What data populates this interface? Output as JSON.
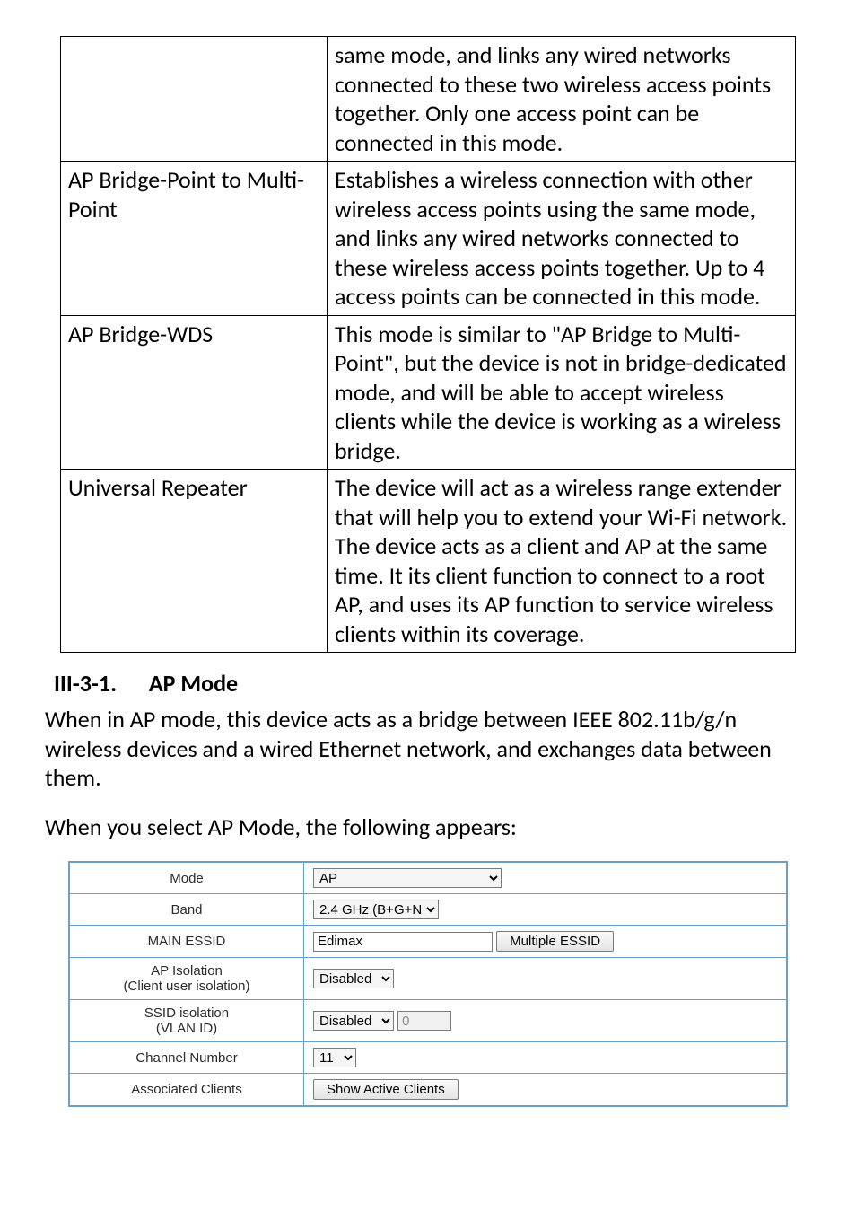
{
  "ref_table": {
    "rows": [
      {
        "label": "",
        "desc": "same mode, and links any wired networks connected to these two wireless access points together. Only one access point can be connected in this mode."
      },
      {
        "label": "AP Bridge-Point to Multi-Point",
        "desc": "Establishes a wireless connection with other wireless access points using the same mode, and links any wired networks connected to these wireless access points together. Up to 4 access points can be connected in this mode."
      },
      {
        "label": "AP Bridge-WDS",
        "desc": "This mode is similar to \"AP Bridge to Multi-Point\", but the device is not in bridge-dedicated mode, and will be able to accept wireless clients while the device is working as a wireless bridge."
      },
      {
        "label": "Universal Repeater",
        "desc": "The device will act as a wireless range extender that will help you to extend your Wi-Fi network. The device acts as a client and AP at the same time. It its client function to connect to a root AP, and uses its AP function to service wireless clients within its coverage."
      }
    ]
  },
  "section": {
    "number": "III-3-1.",
    "title": "AP Mode",
    "para1": "When in AP mode, this device acts as a bridge between IEEE 802.11b/g/n wireless devices and a wired Ethernet network, and exchanges data between them.",
    "para2": "When you select AP Mode, the following appears:"
  },
  "settings": {
    "mode_label": "Mode",
    "mode_value": "AP",
    "band_label": "Band",
    "band_value": "2.4 GHz (B+G+N)",
    "main_essid_label": "MAIN ESSID",
    "main_essid_value": "Edimax",
    "multiple_essid_btn": "Multiple ESSID",
    "ap_iso_label_line1": "AP Isolation",
    "ap_iso_label_line2": "(Client user isolation)",
    "ap_iso_value": "Disabled",
    "ssid_iso_label_line1": "SSID isolation",
    "ssid_iso_label_line2": "(VLAN ID)",
    "ssid_iso_value": "Disabled",
    "ssid_iso_vlan": "0",
    "channel_label": "Channel Number",
    "channel_value": "11",
    "assoc_clients_label": "Associated Clients",
    "assoc_clients_btn": "Show Active Clients"
  }
}
